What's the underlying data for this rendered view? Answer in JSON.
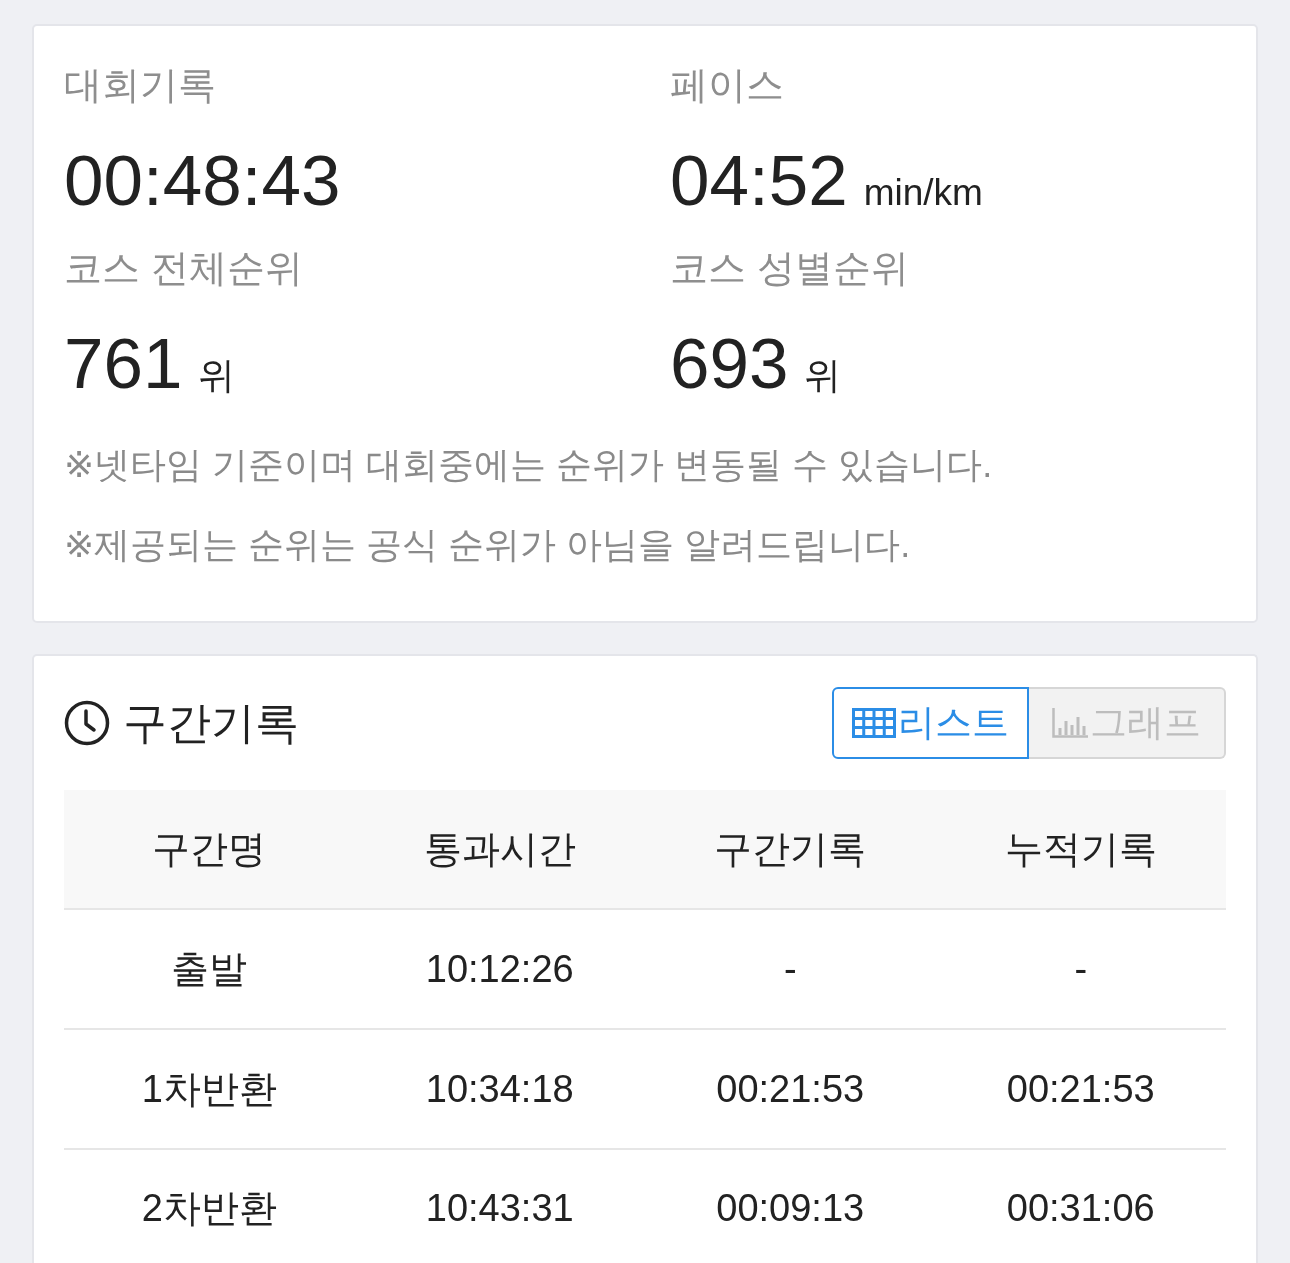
{
  "summary": {
    "stats": [
      {
        "label": "대회기록",
        "value": "00:48:43"
      },
      {
        "label": "페이스",
        "value": "04:52",
        "unit": "min/km"
      },
      {
        "label": "코스 전체순위",
        "value": "761",
        "unit": "위"
      },
      {
        "label": "코스 성별순위",
        "value": "693",
        "unit": "위"
      }
    ],
    "notes": [
      "※넷타임 기준이며 대회중에는 순위가 변동될 수 있습니다.",
      "※제공되는 순위는 공식 순위가 아님을 알려드립니다."
    ]
  },
  "splits": {
    "title": "구간기록",
    "view_tabs": [
      {
        "kind": "list",
        "label": "리스트",
        "selected": true
      },
      {
        "kind": "graph",
        "label": "그래프",
        "selected": false
      }
    ],
    "table": {
      "columns": [
        "구간명",
        "통과시간",
        "구간기록",
        "누적기록"
      ],
      "rows": [
        [
          "출발",
          "10:12:26",
          "-",
          "-"
        ],
        [
          "1차반환",
          "10:34:18",
          "00:21:53",
          "00:21:53"
        ],
        [
          "2차반환",
          "10:43:31",
          "00:09:13",
          "00:31:06"
        ]
      ]
    }
  }
}
